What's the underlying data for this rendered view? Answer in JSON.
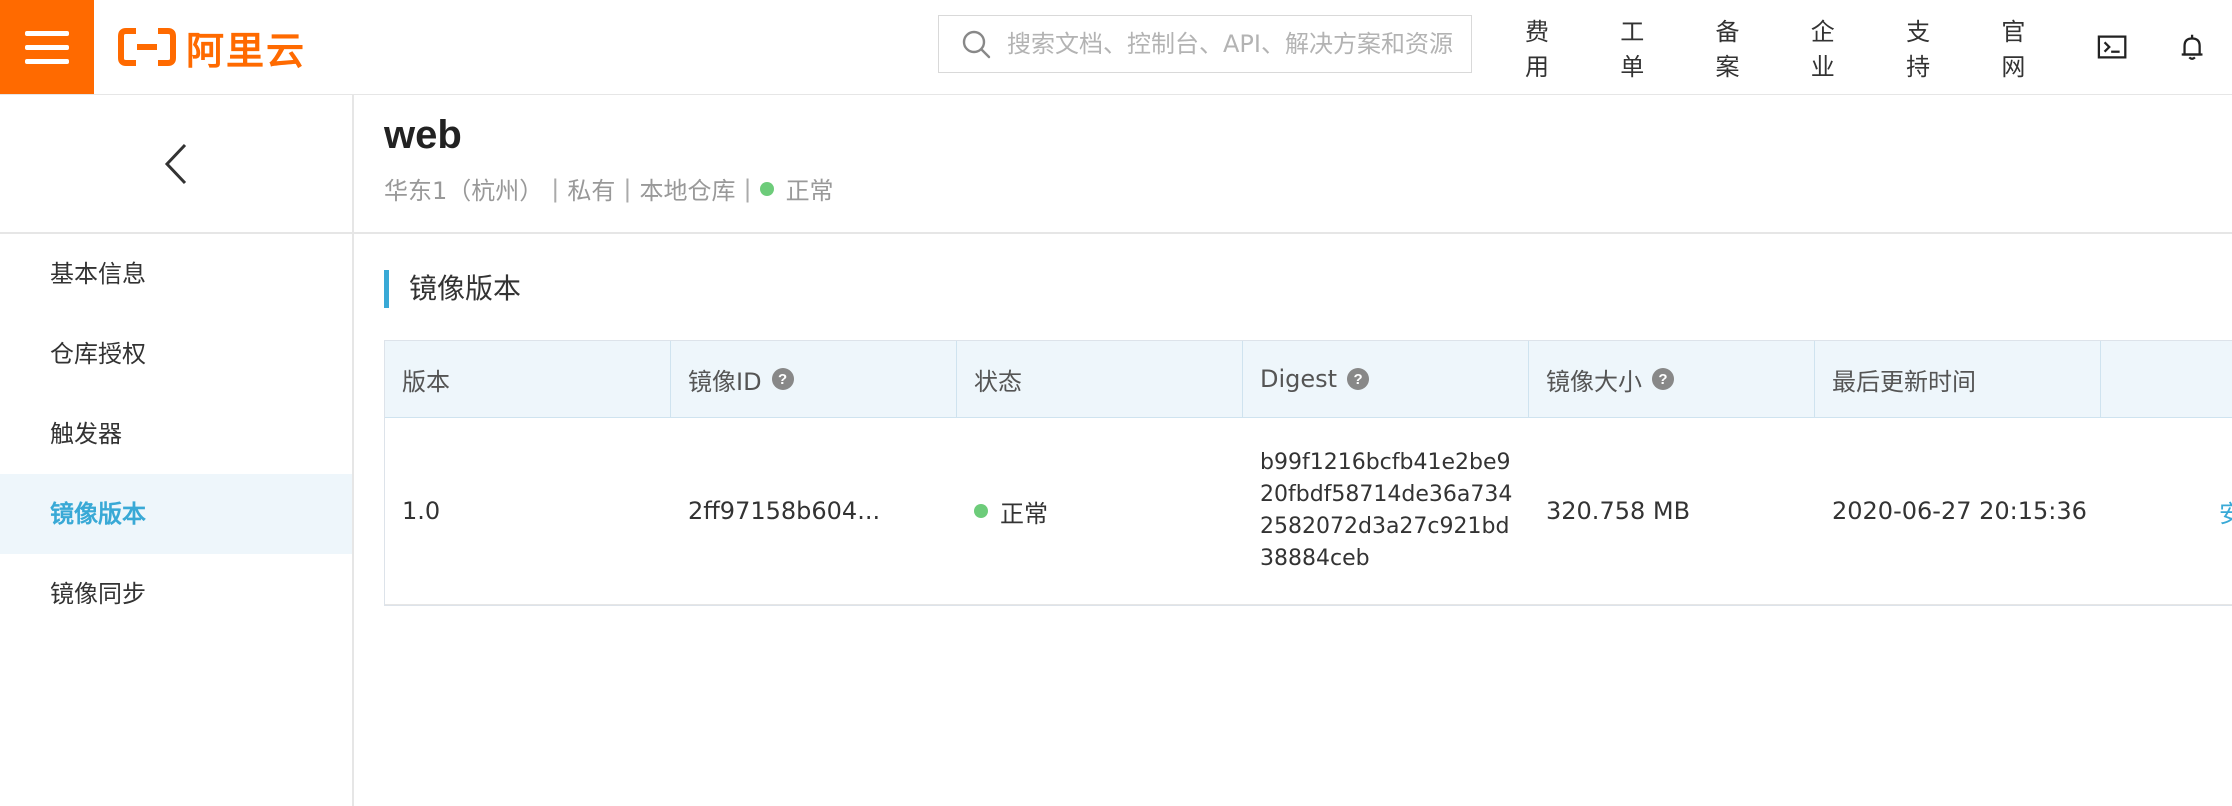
{
  "topbar": {
    "brand_name": "阿里云",
    "brand_color": "#ff6a00",
    "search_placeholder": "搜索文档、控制台、API、解决方案和资源",
    "nav_items": [
      "费用",
      "工单",
      "备案",
      "企业",
      "支持",
      "官网"
    ],
    "icons": [
      "terminal-icon",
      "bell-icon"
    ]
  },
  "sidebar": {
    "back_icon": "chevron-left-icon",
    "items": [
      {
        "label": "基本信息"
      },
      {
        "label": "仓库授权"
      },
      {
        "label": "触发器"
      },
      {
        "label": "镜像版本",
        "active": true
      },
      {
        "label": "镜像同步"
      }
    ]
  },
  "repo": {
    "name": "web",
    "region": "华东1（杭州）",
    "visibility": "私有",
    "source": "本地仓库",
    "status": "正常",
    "status_color": "#6dcc7a"
  },
  "section": {
    "title": "镜像版本"
  },
  "table": {
    "columns": [
      "版本",
      "镜像ID",
      "状态",
      "Digest",
      "镜像大小",
      "最后更新时间",
      ""
    ],
    "rows": [
      {
        "version": "1.0",
        "image_id": "2ff97158b604...",
        "status": "正常",
        "digest_lines": [
          "b99f1216bcfb41e2be9",
          "20fbdf58714de36a734",
          "2582072d3a27c921bd",
          "38884ceb"
        ],
        "size": "320.758 MB",
        "updated": "2020-06-27 20:15:36",
        "action": "安"
      }
    ]
  },
  "accent_color": "#39a9d6"
}
